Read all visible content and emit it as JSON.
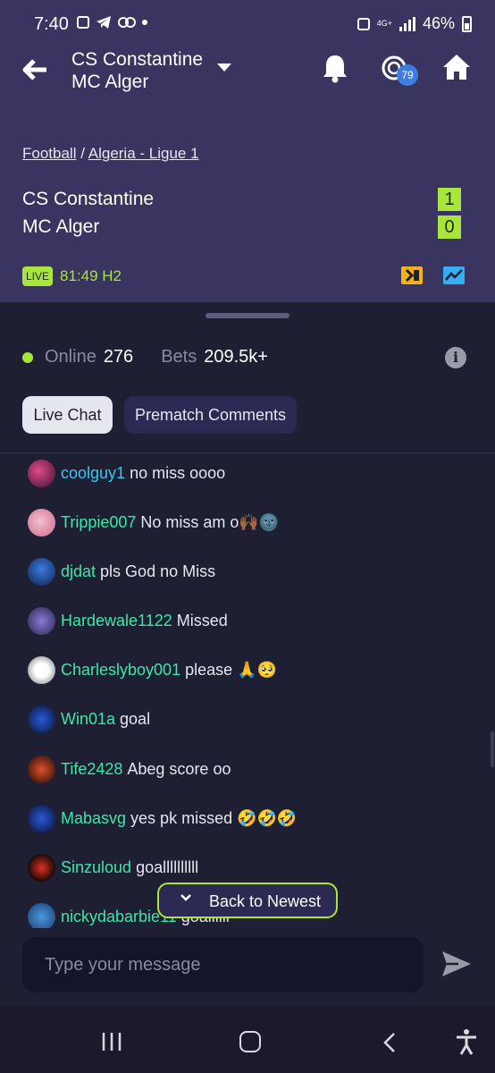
{
  "status_bar": {
    "time": "7:40",
    "network": "4G+",
    "battery": "46%"
  },
  "header": {
    "title_line1": "CS Constantine",
    "title_line2": "MC Alger",
    "coin_badge": "79"
  },
  "match": {
    "breadcrumb_sport": "Football",
    "breadcrumb_sep": "/",
    "breadcrumb_league": "Algeria - Ligue 1",
    "home_team": "CS Constantine",
    "away_team": "MC Alger",
    "home_score": "1",
    "away_score": "0",
    "live_label": "LIVE",
    "clock": "81:49 H2"
  },
  "stats": {
    "online_label": "Online",
    "online_count": "276",
    "bets_label": "Bets",
    "bets_count": "209.5k+"
  },
  "tabs": {
    "live_chat": "Live Chat",
    "prematch": "Prematch Comments"
  },
  "messages": [
    {
      "user": "coolguy1",
      "text": "no miss oooo"
    },
    {
      "user": "Trippie007",
      "text": "No miss am o🙌🏾🌚"
    },
    {
      "user": "djdat",
      "text": "pls God no Miss"
    },
    {
      "user": "Hardewale1122",
      "text": "Missed"
    },
    {
      "user": "Charleslyboy001",
      "text": "please 🙏🥺"
    },
    {
      "user": "Win01a",
      "text": "goal"
    },
    {
      "user": "Tife2428",
      "text": "Abeg score oo"
    },
    {
      "user": "Mabasvg",
      "text": "yes pk missed 🤣🤣🤣"
    },
    {
      "user": "Sinzuloud",
      "text": "goallllllllll"
    },
    {
      "user": "nickydabarbie11",
      "text": "goallllll"
    }
  ],
  "back_to_newest": "Back to Newest",
  "composer": {
    "placeholder": "Type your message"
  },
  "colors": {
    "accent": "#a8e63c",
    "header_bg": "#3a3461",
    "sheet_bg": "#1f1f33",
    "username": "#3ee6a8"
  }
}
